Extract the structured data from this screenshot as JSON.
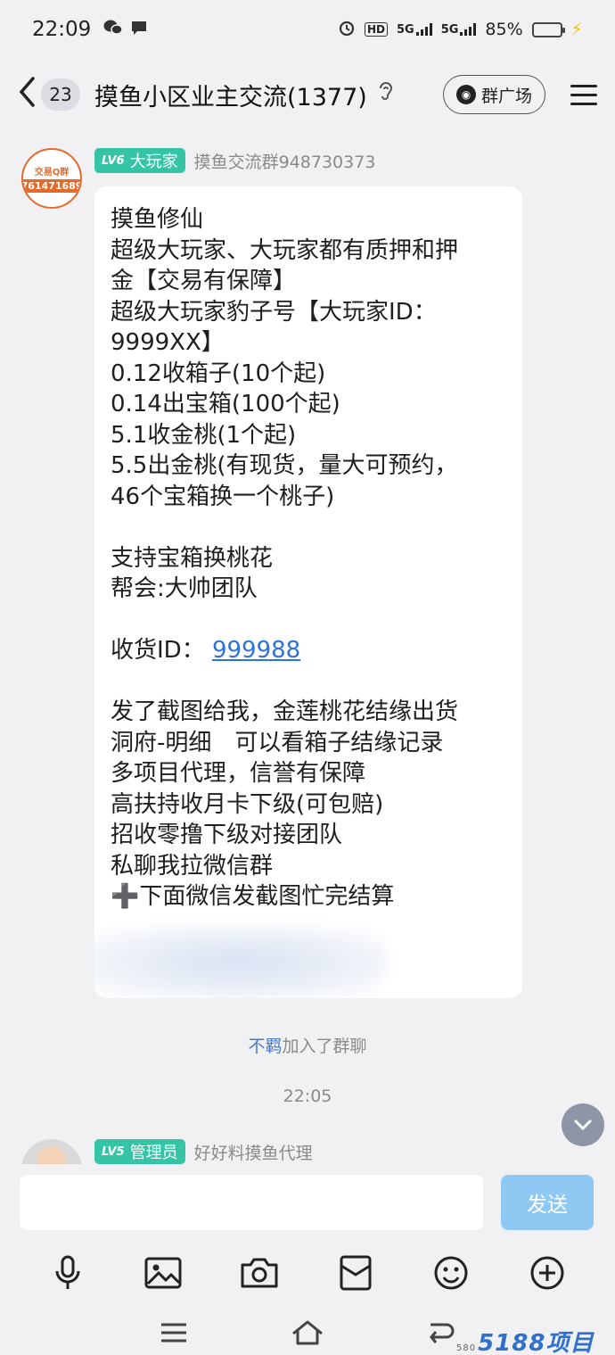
{
  "status_bar": {
    "time": "22:09",
    "network_1": "5G",
    "network_2": "5G",
    "hd_label": "HD",
    "battery": "85%",
    "battery_level": 0.85
  },
  "header": {
    "unread_count": "23",
    "title": "摸鱼小区业主交流(1377)",
    "plaza_button": "群广场"
  },
  "message1": {
    "avatar_top_text": "交易Q群",
    "avatar_number": "761471689",
    "level_code": "LV6",
    "level_title": "大玩家",
    "sender": "摸鱼交流群948730373",
    "lines": [
      "摸鱼修仙",
      "超级大玩家、大玩家都有质押和押",
      "金【交易有保障】",
      "超级大玩家豹子号【大玩家ID：",
      "9999XX】",
      "0.12收箱子(10个起)",
      "0.14出宝箱(100个起)",
      "5.1收金桃(1个起)",
      "5.5出金桃(有现货，量大可预约，",
      "46个宝箱换一个桃子)",
      "",
      "支持宝箱换桃花",
      "帮会:大帅团队",
      ""
    ],
    "receive_label": "收货ID：",
    "receive_id": "999988",
    "lines_after": [
      "",
      "发了截图给我，金莲桃花结缘出货",
      "洞府-明细　可以看箱子结缘记录",
      "多项目代理，信誉有保障",
      "高扶持收月卡下级(可包赔)",
      "招收零撸下级对接团队",
      "私聊我拉微信群",
      "➕下面微信发截图忙完结算"
    ]
  },
  "system_notice": {
    "user": "不羁",
    "action": "加入了群聊"
  },
  "timestamp": "22:05",
  "message2": {
    "level_code": "LV5",
    "level_title": "管理员",
    "sender": "好好料摸鱼代理"
  },
  "input": {
    "placeholder": "",
    "send_label": "发送"
  },
  "watermark": {
    "small": "580",
    "text": "5188项目网"
  },
  "colors": {
    "level_badge": "#35c5a6",
    "link": "#2f73d6",
    "send_button": "#8fc9f3"
  }
}
